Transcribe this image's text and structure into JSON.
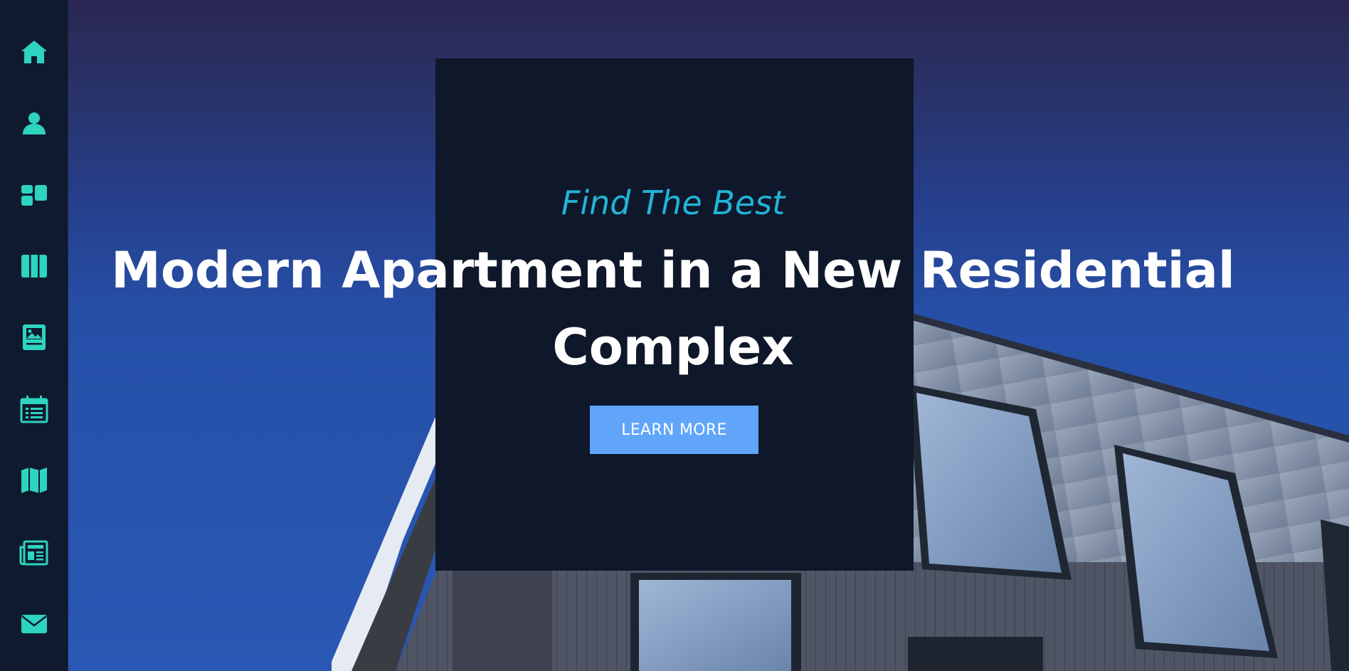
{
  "sidebar": {
    "accent": "#2dd4bf",
    "items": [
      {
        "icon": "home-icon"
      },
      {
        "icon": "user-icon"
      },
      {
        "icon": "dashboard-icon"
      },
      {
        "icon": "columns-icon"
      },
      {
        "icon": "image-icon"
      },
      {
        "icon": "calendar-list-icon"
      },
      {
        "icon": "map-icon"
      },
      {
        "icon": "newspaper-icon"
      },
      {
        "icon": "envelope-icon"
      }
    ]
  },
  "hero": {
    "kicker": "Find The Best",
    "headline": "Modern Apartment in a New Residential Complex",
    "button_label": "LEARN MORE",
    "button_color": "#60a5fa",
    "kicker_color": "#22b4d6",
    "card_color": "#0f172a"
  }
}
